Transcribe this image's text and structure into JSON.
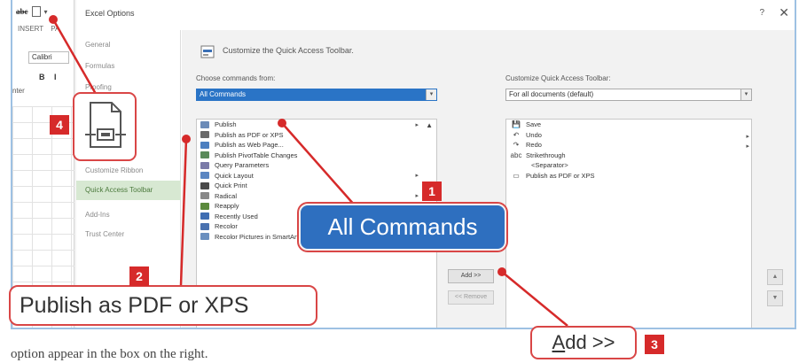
{
  "excel": {
    "qat_ab": "abc",
    "tab_insert": "INSERT",
    "tab_next": "PA",
    "font_name": "Calibri",
    "bold_italic": "B I",
    "enter_label": "nter"
  },
  "dialog": {
    "title": "Excel Options",
    "help": "?",
    "close": "✕",
    "nav": [
      "General",
      "Formulas",
      "Proofing",
      "Customize Ribbon",
      "Quick Access Toolbar",
      "Add-Ins",
      "Trust Center"
    ],
    "active_nav": "Quick Access Toolbar",
    "header": "Customize the Quick Access Toolbar.",
    "choose_label": "Choose commands from:",
    "choose_value": "All Commands",
    "customize_label": "Customize Quick Access Toolbar:",
    "customize_value": "For all documents (default)",
    "commands": [
      {
        "label": "Publish",
        "color": "#6b8bb8",
        "marker": "▸"
      },
      {
        "label": "Publish as PDF or XPS",
        "color": "#6a6a6a",
        "marker": ""
      },
      {
        "label": "Publish as Web Page...",
        "color": "#4c7fc0",
        "marker": ""
      },
      {
        "label": "Publish PivotTable Changes",
        "color": "#5a8a5a",
        "marker": ""
      },
      {
        "label": "Query Parameters",
        "color": "#7a7aa8",
        "marker": ""
      },
      {
        "label": "Quick Layout",
        "color": "#5b86c2",
        "marker": "▸"
      },
      {
        "label": "Quick Print",
        "color": "#4a4a4a",
        "marker": ""
      },
      {
        "label": "Radical",
        "color": "#888888",
        "marker": "▸"
      },
      {
        "label": "Reapply",
        "color": "#5b8a3c",
        "marker": ""
      },
      {
        "label": "Recently Used",
        "color": "#3f6db2",
        "marker": "▸"
      },
      {
        "label": "Recolor",
        "color": "#4a72b0",
        "marker": "▸"
      },
      {
        "label": "Recolor Pictures in SmartArt Graphic",
        "color": "#6a8fbf",
        "marker": ""
      }
    ],
    "scroll_up": "▲",
    "qat_items": [
      {
        "sym": "💾",
        "label": "Save"
      },
      {
        "sym": "↶",
        "label": "Undo"
      },
      {
        "sym": "↷",
        "label": "Redo"
      },
      {
        "sym": "abc",
        "label": "Strikethrough"
      },
      {
        "sym": "",
        "label": "<Separator>"
      },
      {
        "sym": "▭",
        "label": "Publish as PDF or XPS"
      }
    ],
    "qat_marks": "▸\n▸",
    "add_button": "Add >>",
    "remove_button": "<< Remove",
    "move_up": "▲",
    "move_down": "▼"
  },
  "callouts": {
    "badge1": "1",
    "badge2": "2",
    "badge3": "3",
    "badge4": "4",
    "all_commands": "All Commands",
    "publish_pdf": "Publish as PDF or XPS",
    "add_a": "A",
    "add_rest": "dd >>"
  },
  "caption": "option appear in the box on the right."
}
